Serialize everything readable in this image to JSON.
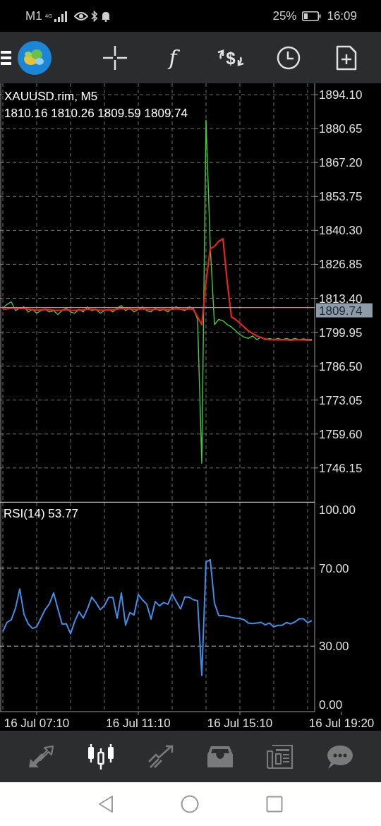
{
  "status_bar": {
    "carrier": "M1",
    "network": "4G",
    "battery": "25%",
    "time": "16:09"
  },
  "toolbar": [
    {
      "kind": "crosshair"
    },
    {
      "kind": "function",
      "label": "f"
    },
    {
      "kind": "exchange",
      "label": "$"
    },
    {
      "kind": "clock"
    },
    {
      "kind": "new_document"
    }
  ],
  "price_chart": {
    "title": "XAUUSD.rim, M5",
    "ohlc": "1810.16 1810.26 1809.59 1809.74",
    "chart_data": {
      "type": "line",
      "grid": true,
      "ylim": [
        1732.4,
        1898.6
      ],
      "categories": [
        null,
        null,
        null,
        null,
        null,
        null,
        null,
        null,
        null,
        null,
        null,
        null,
        null,
        null,
        null,
        null,
        null,
        null,
        null,
        null,
        null,
        null,
        null,
        null,
        null,
        null,
        null,
        null,
        null,
        null,
        null,
        null,
        null,
        null,
        null,
        null,
        null,
        null,
        null,
        null,
        null,
        null,
        null,
        null,
        null,
        null,
        null,
        null,
        null,
        null,
        null,
        null,
        null,
        null,
        null,
        null,
        null,
        null,
        null,
        null,
        null,
        null,
        null,
        null,
        null,
        null,
        null,
        null,
        null,
        null,
        null,
        null,
        null,
        null,
        null,
        null,
        null,
        null,
        null,
        null,
        null
      ],
      "series": [
        {
          "color": "#3ecf3e",
          "values": [
            1809.5,
            1811,
            1812,
            1808.5,
            1809.5,
            1810,
            1808,
            1809,
            1807.5,
            1808.5,
            1809,
            1808,
            1808.5,
            1807,
            1808.5,
            1809.5,
            1808,
            1807.5,
            1809,
            1808,
            1810,
            1808.5,
            1809,
            1807.5,
            1808.5,
            1809,
            1808,
            1809.5,
            1810.5,
            1808.5,
            1809.5,
            1808,
            1809,
            1810,
            1808.5,
            1808,
            1809.5,
            1808.5,
            1809,
            1808,
            1809.5,
            1810,
            1809,
            1808.5,
            1810,
            1809.5,
            1805,
            1748,
            1884,
            1834,
            1803,
            1805,
            1804.5,
            1803,
            1802,
            1800.5,
            1799,
            1798,
            1797.5,
            1798.5,
            1797,
            1798,
            1797,
            1797.5,
            1797,
            1797.5,
            1797,
            1797.5,
            1797,
            1797.5,
            1797,
            1797.3,
            1797,
            1797.2,
            null,
            null,
            null,
            null,
            null,
            null,
            null
          ]
        },
        {
          "color": "#e8231c",
          "values": [
            1809,
            1809.2,
            1809.6,
            1809.5,
            1809.3,
            1809.4,
            1809.1,
            1808.9,
            1808.7,
            1808.8,
            1809,
            1808.9,
            1808.7,
            1808.6,
            1808.7,
            1808.9,
            1808.7,
            1808.6,
            1808.7,
            1808.8,
            1809.1,
            1809,
            1808.9,
            1808.7,
            1808.7,
            1808.9,
            1808.8,
            1809.1,
            1809.3,
            1809.2,
            1809.2,
            1809,
            1809,
            1809.2,
            1809.1,
            1808.9,
            1809,
            1809,
            1809.1,
            1808.9,
            1809,
            1809.2,
            1809.1,
            1809,
            1809.2,
            1809.1,
            1806,
            1803,
            1820,
            1833,
            1834,
            1836,
            1837,
            1820,
            1806,
            1805,
            1803.5,
            1802,
            1800.5,
            1799.5,
            1798.5,
            1797.8,
            1797.3,
            1797,
            1797,
            1796.9,
            1797,
            1796.9,
            1796.8,
            1796.9,
            1797,
            1796.9,
            1796.8,
            1796.8,
            null,
            null,
            null,
            null,
            null,
            null,
            null
          ]
        }
      ],
      "yticks": [
        {
          "value": 1894.1,
          "label": "1894.10"
        },
        {
          "value": 1880.65,
          "label": "1880.65"
        },
        {
          "value": 1867.2,
          "label": "1867.20"
        },
        {
          "value": 1853.75,
          "label": "1853.75"
        },
        {
          "value": 1840.3,
          "label": "1840.30"
        },
        {
          "value": 1826.85,
          "label": "1826.85"
        },
        {
          "value": 1813.4,
          "label": "1813.40"
        },
        {
          "value": 1799.95,
          "label": "1799.95"
        },
        {
          "value": 1786.5,
          "label": "1786.50"
        },
        {
          "value": 1773.05,
          "label": "1773.05"
        },
        {
          "value": 1759.6,
          "label": "1759.60"
        },
        {
          "value": 1746.15,
          "label": "1746.15"
        }
      ],
      "ref_lines": [
        {
          "axis": "y",
          "value": 1809.74,
          "label": "1809.74",
          "color": "#c08898"
        }
      ]
    }
  },
  "rsi_chart": {
    "title": "RSI(14) 53.77",
    "chart_data": {
      "type": "line",
      "grid": true,
      "ylim": [
        -3.6,
        103.6
      ],
      "categories": [
        null,
        null,
        null,
        null,
        null,
        null,
        null,
        null,
        "16 Jul 07:10",
        null,
        null,
        null,
        null,
        null,
        null,
        null,
        null,
        null,
        null,
        null,
        null,
        null,
        null,
        null,
        null,
        null,
        null,
        null,
        null,
        null,
        null,
        null,
        "16 Jul 11:10",
        null,
        null,
        null,
        null,
        null,
        null,
        null,
        null,
        null,
        null,
        null,
        null,
        null,
        null,
        null,
        null,
        null,
        null,
        null,
        null,
        null,
        null,
        null,
        "16 Jul 15:10",
        null,
        null,
        null,
        null,
        null,
        null,
        null,
        null,
        null,
        null,
        null,
        null,
        null,
        null,
        null,
        null,
        null,
        null,
        null,
        null,
        null,
        null,
        null,
        "16 Jul 19:20"
      ],
      "series": [
        {
          "color": "#3d8fe8",
          "values": [
            37.5,
            42.2,
            43.5,
            49.5,
            59.3,
            46.3,
            41.4,
            39.1,
            39.9,
            44.4,
            48.8,
            51.7,
            57.3,
            49.1,
            41.3,
            41.5,
            36.4,
            42.8,
            47.7,
            44.4,
            49.2,
            55.1,
            52.4,
            48.7,
            50.8,
            55,
            55,
            44.3,
            57.2,
            40.8,
            47.2,
            46,
            56.5,
            53.7,
            51.5,
            43.8,
            52.8,
            50.7,
            52.4,
            51.5,
            56.7,
            52.8,
            49.1,
            55.2,
            55.1,
            53.8,
            53.3,
            15,
            73.1,
            74.3,
            52,
            45.7,
            45.7,
            45.3,
            44.8,
            44.4,
            44.2,
            43.5,
            41.9,
            41.6,
            41.9,
            42.2,
            40.9,
            41.9,
            39.9,
            40.7,
            40.7,
            42.1,
            41.4,
            42.4,
            44,
            44,
            42,
            43.1,
            null,
            null,
            null,
            null,
            null,
            null,
            null
          ]
        }
      ],
      "yticks": [
        {
          "value": 100,
          "label": "100.00"
        },
        {
          "value": 70,
          "label": "70.00"
        },
        {
          "value": 30,
          "label": "30.00"
        },
        {
          "value": 0,
          "label": "0.00"
        }
      ],
      "ref_lines": [
        {
          "axis": "y",
          "value": 70
        },
        {
          "axis": "y",
          "value": 30
        }
      ]
    }
  },
  "tabs": [
    {
      "kind": "quotes",
      "selected": false
    },
    {
      "kind": "chart",
      "selected": true
    },
    {
      "kind": "trade",
      "selected": false
    },
    {
      "kind": "history",
      "selected": false
    },
    {
      "kind": "news",
      "selected": false
    },
    {
      "kind": "chat",
      "selected": false
    }
  ]
}
